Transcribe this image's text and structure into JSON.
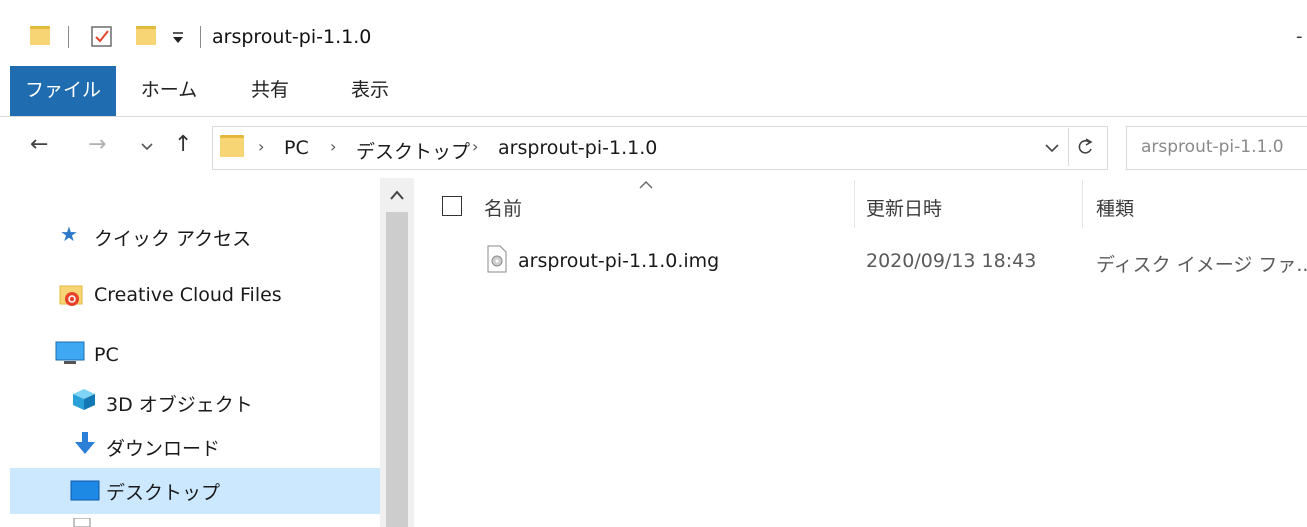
{
  "window": {
    "title": "arsprout-pi-1.1.0"
  },
  "ribbon": {
    "tabs": [
      "ファイル",
      "ホーム",
      "共有",
      "表示"
    ]
  },
  "address": {
    "crumbs": [
      "PC",
      "デスクトップ",
      "arsprout-pi-1.1.0"
    ],
    "search_placeholder": "arsprout-pi-1.1.0"
  },
  "nav": {
    "quick_access": "クイック アクセス",
    "creative_cloud": "Creative Cloud Files",
    "pc": "PC",
    "objects3d": "3D オブジェクト",
    "downloads": "ダウンロード",
    "desktop": "デスクトップ"
  },
  "columns": {
    "name": "名前",
    "modified": "更新日時",
    "type": "種類"
  },
  "files": [
    {
      "name": "arsprout-pi-1.1.0.img",
      "modified": "2020/09/13 18:43",
      "type": "ディスク イメージ ファ..."
    }
  ],
  "colors": {
    "accent": "#1f6db0",
    "selection": "#cce8ff",
    "folder": "#f7d574"
  }
}
